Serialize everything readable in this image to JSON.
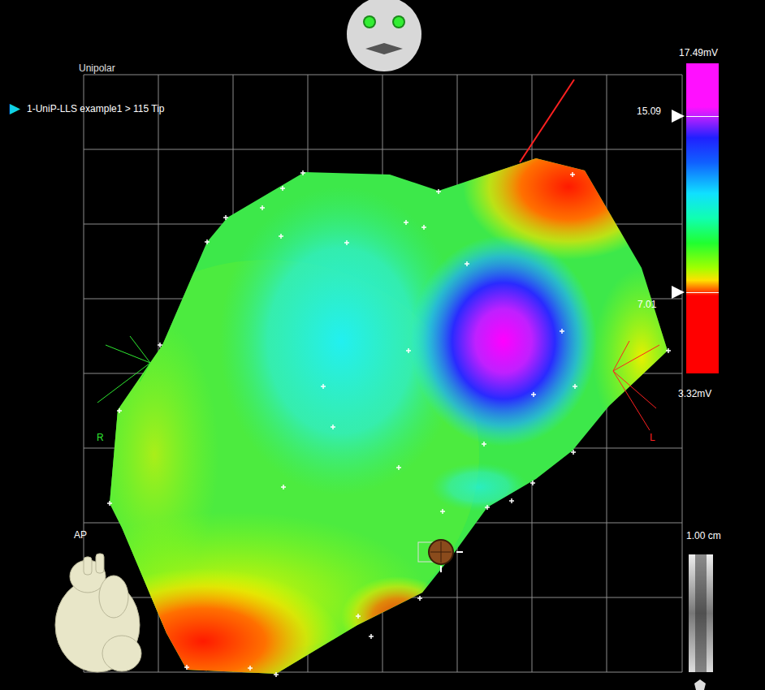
{
  "view": {
    "mode": "Unipolar",
    "orientation": "AP"
  },
  "map": {
    "marker": "▶",
    "label": "1-UniP-LLS example1 > 115 Tip"
  },
  "color_scale": {
    "max": "17.49mV",
    "upper": "15.09",
    "lower": "7.01",
    "min": "3.32mV"
  },
  "axes": {
    "right": "R",
    "left": "L"
  },
  "scale_bar": {
    "label": "1.00 cm"
  }
}
